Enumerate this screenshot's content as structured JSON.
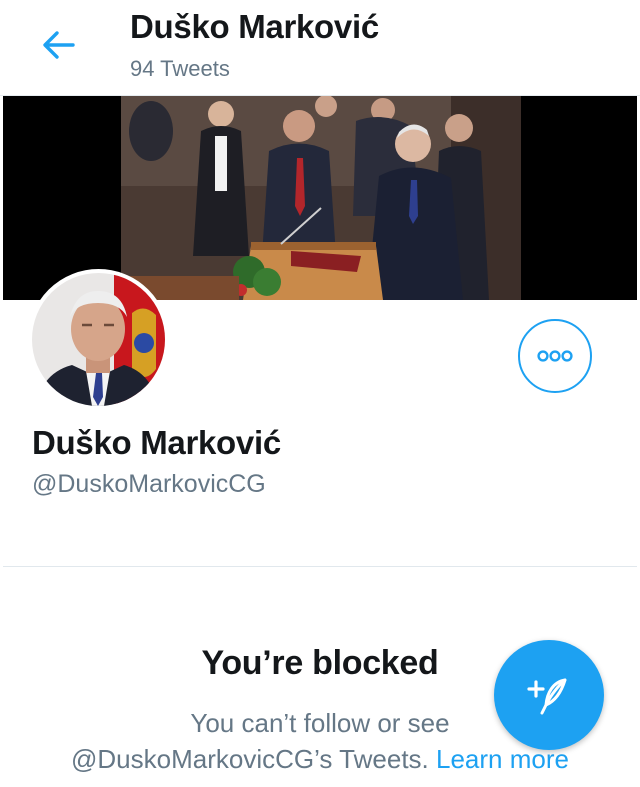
{
  "header": {
    "name": "Duško Marković",
    "tweet_count": "94 Tweets"
  },
  "profile": {
    "display_name": "Duško Marković",
    "handle": "@DuskoMarkovicCG"
  },
  "blocked": {
    "title": "You’re blocked",
    "line1": "You can’t follow or see",
    "line2": "@DuskoMarkovicCG’s Tweets.",
    "learn_more": "Learn more"
  },
  "icons": {
    "back": "back-arrow-icon",
    "more": "more-dots-icon",
    "compose": "compose-tweet-icon"
  },
  "colors": {
    "accent": "#1da1f2",
    "secondary_text": "#657786",
    "primary_text": "#14171a"
  }
}
